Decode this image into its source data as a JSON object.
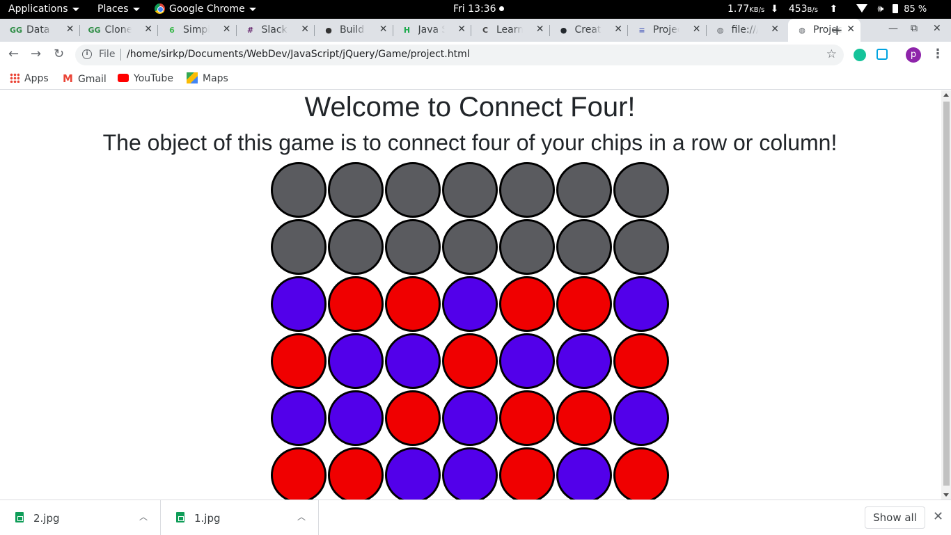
{
  "system_bar": {
    "applications": "Applications",
    "places": "Places",
    "app_name": "Google Chrome",
    "clock": "Fri 13:36",
    "download_speed": "1.77",
    "download_unit": "KB/s",
    "upload_speed": "453",
    "upload_unit": "B/s",
    "battery": "85 %"
  },
  "tabs": [
    {
      "title": "Data S",
      "icon": "gfg-icon",
      "icon_char": "GG",
      "icon_color": "#2f8d46"
    },
    {
      "title": "Clone",
      "icon": "gfg-icon",
      "icon_char": "GG",
      "icon_color": "#2f8d46"
    },
    {
      "title": "Simple",
      "icon": "leaf-icon",
      "icon_char": "6",
      "icon_color": "#3fb950"
    },
    {
      "title": "Slack |",
      "icon": "slack-icon",
      "icon_char": "#",
      "icon_color": "#611f69"
    },
    {
      "title": "Build r",
      "icon": "bear-icon",
      "icon_char": "●",
      "icon_color": "#333333"
    },
    {
      "title": "Java S",
      "icon": "hackerrank-icon",
      "icon_char": "H",
      "icon_color": "#1ba94c"
    },
    {
      "title": "Learn",
      "icon": "course-icon",
      "icon_char": "C",
      "icon_color": "#444444"
    },
    {
      "title": "Create",
      "icon": "github-icon",
      "icon_char": "●",
      "icon_color": "#24292e"
    },
    {
      "title": "Projec",
      "icon": "docs-icon",
      "icon_char": "≡",
      "icon_color": "#5c6bc0"
    },
    {
      "title": "file:///",
      "icon": "globe-icon",
      "icon_char": "◍",
      "icon_color": "#5f6368"
    },
    {
      "title": "Projec",
      "icon": "globe-icon",
      "icon_char": "◍",
      "icon_color": "#5f6368"
    }
  ],
  "omnibox": {
    "scheme_label": "File",
    "url": "/home/sirkp/Documents/WebDev/JavaScript/jQuery/Game/project.html"
  },
  "profile_initial": "p",
  "bookmarks": [
    {
      "label": "Apps",
      "icon": "apps-icon"
    },
    {
      "label": "Gmail",
      "icon": "gmail-icon"
    },
    {
      "label": "YouTube",
      "icon": "youtube-icon"
    },
    {
      "label": "Maps",
      "icon": "maps-icon"
    }
  ],
  "page": {
    "title": "Welcome to Connect Four!",
    "subtitle": "The object of this game is to connect four of your chips in a row or column!",
    "colors": {
      "empty": "#5a5b5f",
      "red": "#f00000",
      "blue": "#5200ea"
    },
    "board": [
      [
        "empty",
        "empty",
        "empty",
        "empty",
        "empty",
        "empty",
        "empty"
      ],
      [
        "empty",
        "empty",
        "empty",
        "empty",
        "empty",
        "empty",
        "empty"
      ],
      [
        "blue",
        "red",
        "red",
        "blue",
        "red",
        "red",
        "blue"
      ],
      [
        "red",
        "blue",
        "blue",
        "red",
        "blue",
        "blue",
        "red"
      ],
      [
        "blue",
        "blue",
        "red",
        "blue",
        "red",
        "red",
        "blue"
      ],
      [
        "red",
        "red",
        "blue",
        "blue",
        "red",
        "blue",
        "red"
      ]
    ]
  },
  "downloads": {
    "items": [
      {
        "name": "2.jpg"
      },
      {
        "name": "1.jpg"
      }
    ],
    "show_all": "Show all"
  }
}
